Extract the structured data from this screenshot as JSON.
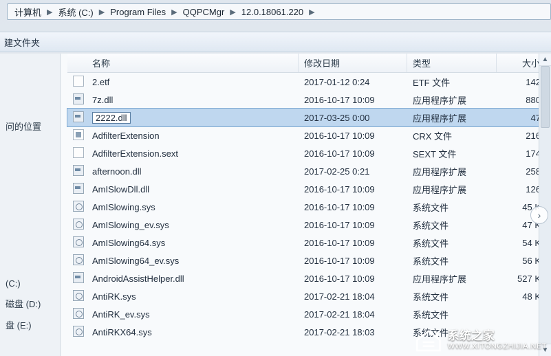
{
  "breadcrumbs": [
    "计算机",
    "系统 (C:)",
    "Program Files",
    "QQPCMgr",
    "12.0.18061.220"
  ],
  "toolbar": {
    "new_folder": "建文件夹"
  },
  "sidebar": {
    "recent_label": "问的位置",
    "drive_c": "(C:)",
    "drive_d": "磁盘 (D:)",
    "drive_e": "盘 (E:)"
  },
  "columns": {
    "name": "名称",
    "date": "修改日期",
    "type": "类型",
    "size": "大小"
  },
  "files": [
    {
      "icon": "file",
      "name": "2.etf",
      "date": "2017-01-12 0:24",
      "type": "ETF 文件",
      "size": "142"
    },
    {
      "icon": "dll",
      "name": "7z.dll",
      "date": "2016-10-17 10:09",
      "type": "应用程序扩展",
      "size": "880"
    },
    {
      "icon": "dll",
      "name": "2222.dll",
      "date": "2017-03-25 0:00",
      "type": "应用程序扩展",
      "size": "47",
      "selected": true
    },
    {
      "icon": "crx",
      "name": "AdfilterExtension",
      "date": "2016-10-17 10:09",
      "type": "CRX 文件",
      "size": "216"
    },
    {
      "icon": "file",
      "name": "AdfilterExtension.sext",
      "date": "2016-10-17 10:09",
      "type": "SEXT 文件",
      "size": "174"
    },
    {
      "icon": "dll",
      "name": "afternoon.dll",
      "date": "2017-02-25 0:21",
      "type": "应用程序扩展",
      "size": "258"
    },
    {
      "icon": "dll",
      "name": "AmISlowDll.dll",
      "date": "2016-10-17 10:09",
      "type": "应用程序扩展",
      "size": "126"
    },
    {
      "icon": "sys",
      "name": "AmISlowing.sys",
      "date": "2016-10-17 10:09",
      "type": "系统文件",
      "size": "45 K"
    },
    {
      "icon": "sys",
      "name": "AmISlowing_ev.sys",
      "date": "2016-10-17 10:09",
      "type": "系统文件",
      "size": "47 K"
    },
    {
      "icon": "sys",
      "name": "AmISlowing64.sys",
      "date": "2016-10-17 10:09",
      "type": "系统文件",
      "size": "54 K"
    },
    {
      "icon": "sys",
      "name": "AmISlowing64_ev.sys",
      "date": "2016-10-17 10:09",
      "type": "系统文件",
      "size": "56 K"
    },
    {
      "icon": "dll",
      "name": "AndroidAssistHelper.dll",
      "date": "2016-10-17 10:09",
      "type": "应用程序扩展",
      "size": "527 K"
    },
    {
      "icon": "sys",
      "name": "AntiRK.sys",
      "date": "2017-02-21 18:04",
      "type": "系统文件",
      "size": "48 K"
    },
    {
      "icon": "sys",
      "name": "AntiRK_ev.sys",
      "date": "2017-02-21 18:04",
      "type": "系统文件",
      "size": ""
    },
    {
      "icon": "sys",
      "name": "AntiRKX64.sys",
      "date": "2017-02-21 18:03",
      "type": "系统文件",
      "size": ""
    }
  ],
  "watermark": {
    "title": "系统之家",
    "url": "WWW.XITONGZHIJIA.NET"
  }
}
